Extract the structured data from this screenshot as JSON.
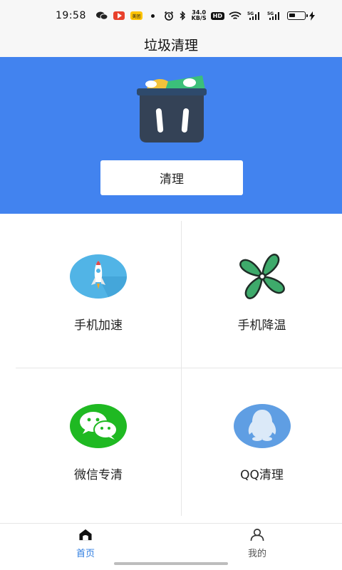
{
  "status_bar": {
    "time": "19:58",
    "net_speed_value": "34.0",
    "net_speed_unit": "KB/S",
    "hd": "HD",
    "sig1": "5G",
    "sig2": "5G",
    "icons": [
      "wechat-icon",
      "video-app-icon",
      "meituan-icon",
      "dot-icon",
      "alarm-icon",
      "bluetooth-icon",
      "wifi-icon",
      "signal-icon",
      "battery-icon",
      "charging-icon"
    ]
  },
  "header": {
    "title": "垃圾清理"
  },
  "hero": {
    "clean_button_label": "清理",
    "background": "#4283ef"
  },
  "grid": {
    "items": [
      {
        "label": "手机加速",
        "icon": "rocket-icon"
      },
      {
        "label": "手机降温",
        "icon": "fan-icon"
      },
      {
        "label": "微信专清",
        "icon": "wechat-icon"
      },
      {
        "label": "QQ清理",
        "icon": "qq-penguin-icon"
      }
    ]
  },
  "bottom_nav": {
    "items": [
      {
        "label": "首页",
        "icon": "home-icon",
        "active": true
      },
      {
        "label": "我的",
        "icon": "user-icon",
        "active": false
      }
    ],
    "active_color": "#2f7de1"
  }
}
